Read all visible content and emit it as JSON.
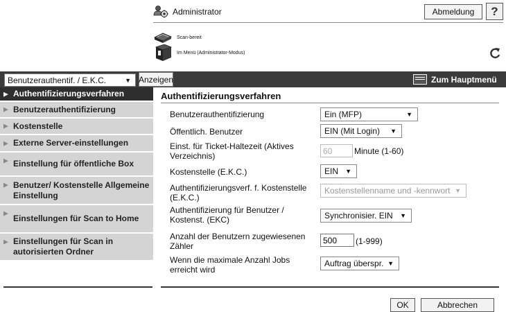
{
  "header": {
    "user_label": "Administrator",
    "logout_label": "Abmeldung",
    "help_label": "?",
    "status_scan": "Scan-bereit",
    "status_mode": "Im Menü (Administrator-Modus)"
  },
  "toolbar": {
    "mode_select_value": "Benutzerauthentif. / E.K.C.",
    "show_label": "Anzeigen",
    "home_label": "Zum Hauptmenü"
  },
  "sidebar": {
    "items": [
      {
        "label": "Authentifizierungsverfahren",
        "active": true
      },
      {
        "label": "Benutzerauthentifizierung",
        "active": false
      },
      {
        "label": "Kostenstelle",
        "active": false
      },
      {
        "label": "Externe Server-einstellungen",
        "active": false
      },
      {
        "label": "Einstellung für öffentliche Box",
        "active": false
      },
      {
        "label": "Benutzer/ Kostenstelle Allgemeine Einstellung",
        "active": false
      },
      {
        "label": "Einstellungen für Scan to Home",
        "active": false
      },
      {
        "label": "Einstellungen für Scan in autorisierten Ordner",
        "active": false
      }
    ]
  },
  "main": {
    "title": "Authentifizierungsverfahren",
    "fields": [
      {
        "label": "Benutzerauthentifizierung",
        "value": "Ein (MFP)"
      },
      {
        "label": "Öffentlich. Benutzer",
        "value": "EIN (Mit Login)"
      },
      {
        "label": "Einst. für Ticket-Haltezeit (Aktives Verzeichnis)",
        "value": "60",
        "unit": "Minute (1-60)"
      },
      {
        "label": "Kostenstelle (E.K.C.)",
        "value": "EIN"
      },
      {
        "label": "Authentifizierungsverf. f. Kostenstelle (E.K.C.)",
        "value": "Kostenstellenname und -kennwort"
      },
      {
        "label": "Authentifizierung für Benutzer / Kostenst. (EKC)",
        "value": "Synchronisier. EIN"
      },
      {
        "label": "Anzahl der Benutzern zugewiesenen Zähler",
        "value": "500",
        "unit": "(1-999)"
      },
      {
        "label": "Wenn die maximale Anzahl Jobs erreicht wird",
        "value": "Auftrag überspr."
      }
    ],
    "ok_label": "OK",
    "cancel_label": "Abbrechen"
  }
}
